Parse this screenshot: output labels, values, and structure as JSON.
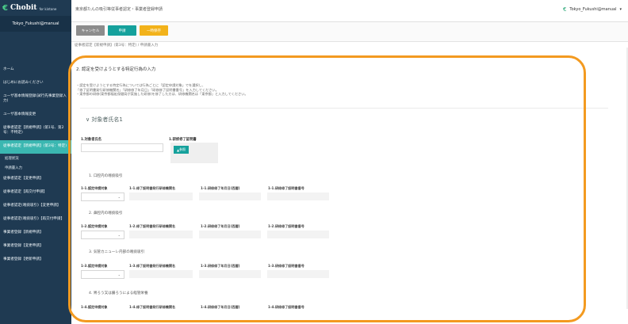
{
  "app": {
    "logo": "Chobit",
    "logo_sub": "for kintone",
    "user": "Tokyo_Fukushi@manual"
  },
  "sidebar": {
    "items": [
      {
        "label": "ホーム"
      },
      {
        "label": "はじめにお読みください"
      },
      {
        "label": "ユーザ基本情報登録(試行先事業登録入力)"
      },
      {
        "label": "ユーザ基本情報変更"
      },
      {
        "label": "従事者認定【新規申請】(第1号、第2号：不特定)"
      },
      {
        "label": "従事者認定【新規申請】(第3号：特定)"
      },
      {
        "label": "従事者認定【変更申請】"
      },
      {
        "label": "従事者認定【再交付申請】"
      },
      {
        "label": "従事者認定(喀痰吸引)【変更申請】"
      },
      {
        "label": "従事者認定(喀痰吸引)【再交付申請】"
      },
      {
        "label": "事業者登録【新規申請】"
      },
      {
        "label": "事業者登録【変更申請】"
      },
      {
        "label": "事業者登録【更新申請】"
      }
    ],
    "subitems": [
      "処理状況",
      "申請書入力"
    ]
  },
  "header": {
    "title": "東京都たんの吸引等従事者認定・事業者登録申請",
    "user": "Tokyo_Fukushi@manual"
  },
  "actions": {
    "cancel": "キャンセル",
    "apply": "申請",
    "save": "一時保存"
  },
  "breadcrumb": "従事者認定【新規申請】(第3号：特定) / 申請書入力",
  "section": {
    "title": "2. 認定を受けようとする特定行為の入力"
  },
  "notes": [
    "・認定を受けようとする特定行為については行為ごとに「認定申請対象」でを選択し、",
    "「修了証明書発行研修機関名」「研修修了年月日」「研修修了証明書番号」を入力してください。",
    "・東京都の研修(東京都福祉保健局が実施した研修)を修了した方は、研修機関名は「東京都」と入力してください。"
  ],
  "card": {
    "title": "∨ 対象者氏名1"
  },
  "subject": {
    "name_label": "1.対象者氏名",
    "file_label": "1.研修修了証明書",
    "file_button": "参照"
  },
  "groups": [
    {
      "title": "1. 口腔内の喀痰吸引",
      "headers": [
        "1-1.認定申請対象",
        "1-1.修了証明書発行研修機関名",
        "1-1.研修修了年月日(西暦)",
        "1-1.研修修了証明書番号"
      ]
    },
    {
      "title": "2. 鼻腔内の喀痰吸引",
      "headers": [
        "1-2.認定申請対象",
        "1-2.修了証明書発行研修機関名",
        "1-2.研修修了年月日(西暦)",
        "1-2.研修修了証明書番号"
      ]
    },
    {
      "title": "3. 気管カニューレ内部の喀痰吸引",
      "headers": [
        "1-3.認定申請対象",
        "1-3.修了証明書発行研修機関名",
        "1-3.研修修了年月日(西暦)",
        "1-3.研修修了証明書番号"
      ]
    },
    {
      "title": "4. 胃ろう又は腸ろうによる経管栄養",
      "headers": [
        "1-4.認定申請対象",
        "1-4.修了証明書発行研修機関名",
        "1-4.研修修了年月日(西暦)",
        "1-4.研修修了証明書番号"
      ]
    }
  ]
}
